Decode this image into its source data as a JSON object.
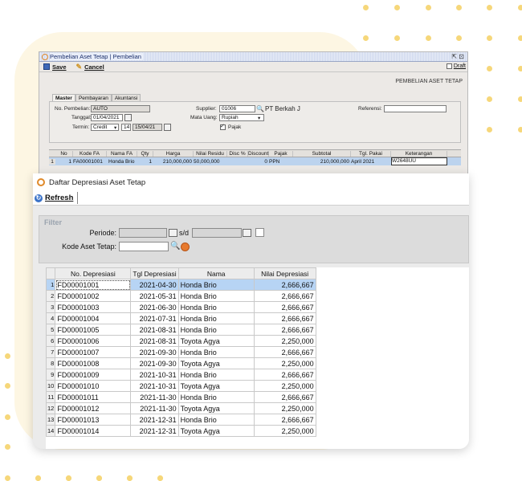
{
  "back_window": {
    "title": "Pembelian Aset Tetap | Pembelian",
    "window_buttons": "ᵒ̲ᶠ ⊞",
    "toolbar": {
      "save": "Save",
      "cancel": "Cancel",
      "draft": "Draft"
    },
    "header_label": "PEMBELIAN ASET TETAP",
    "tabs": [
      "Master",
      "Pembayaran",
      "Akuntansi"
    ],
    "form": {
      "no_pembelian_label": "No. Pembelian:",
      "no_pembelian": "AUTO",
      "tanggal_label": "Tanggal:",
      "tanggal": "01/04/2021",
      "termin_label": "Termin:",
      "termin": "Credit",
      "termin_days": "14",
      "termin_date": "15/04/21",
      "supplier_label": "Supplier:",
      "supplier_code": "01006",
      "supplier_name": "PT Berkah J",
      "mata_uang_label": "Mata Uang:",
      "mata_uang": "Rupiah",
      "pajak_label": "Pajak",
      "referensi_label": "Referensi:"
    },
    "grid": {
      "headers": [
        "No",
        "Kode FA",
        "Nama FA",
        "Qty",
        "Harga",
        "Nilai Residu",
        "Disc %",
        "Discount",
        "Pajak",
        "Subtotal",
        "Tgl. Pakai",
        "Keterangan"
      ],
      "row": {
        "rn": "1",
        "no": "1",
        "kode": "FA00001001",
        "nama": "Honda Brio",
        "qty": "1",
        "harga": "210,000,000",
        "residu": "50,000,000",
        "disc": "",
        "discount": "0",
        "pajak": "PPN",
        "subtotal": "210,000,000",
        "tgl": "April 2021",
        "ket": "W2648UU"
      }
    }
  },
  "front_window": {
    "title": "Daftar Depresiasi Aset Tetap",
    "refresh_label": "Refresh",
    "filter": {
      "title": "Filter",
      "periode_label": "Periode:",
      "sd_label": "s/d",
      "kode_label": "Kode Aset Tetap:"
    },
    "table": {
      "headers": [
        "No. Depresiasi",
        "Tgl Depresiasi",
        "Nama",
        "Nilai Depresiasi"
      ],
      "rows": [
        [
          "FD00001001",
          "2021-04-30",
          "Honda Brio",
          "2,666,667"
        ],
        [
          "FD00001002",
          "2021-05-31",
          "Honda Brio",
          "2,666,667"
        ],
        [
          "FD00001003",
          "2021-06-30",
          "Honda Brio",
          "2,666,667"
        ],
        [
          "FD00001004",
          "2021-07-31",
          "Honda Brio",
          "2,666,667"
        ],
        [
          "FD00001005",
          "2021-08-31",
          "Honda Brio",
          "2,666,667"
        ],
        [
          "FD00001006",
          "2021-08-31",
          "Toyota Agya",
          "2,250,000"
        ],
        [
          "FD00001007",
          "2021-09-30",
          "Honda Brio",
          "2,666,667"
        ],
        [
          "FD00001008",
          "2021-09-30",
          "Toyota Agya",
          "2,250,000"
        ],
        [
          "FD00001009",
          "2021-10-31",
          "Honda Brio",
          "2,666,667"
        ],
        [
          "FD00001010",
          "2021-10-31",
          "Toyota Agya",
          "2,250,000"
        ],
        [
          "FD00001011",
          "2021-11-30",
          "Honda Brio",
          "2,666,667"
        ],
        [
          "FD00001012",
          "2021-11-30",
          "Toyota Agya",
          "2,250,000"
        ],
        [
          "FD00001013",
          "2021-12-31",
          "Honda Brio",
          "2,666,667"
        ],
        [
          "FD00001014",
          "2021-12-31",
          "Toyota Agya",
          "2,250,000"
        ]
      ]
    }
  },
  "colors": {
    "accent_dots": "#f6d77a",
    "selection": "#b7d4f4",
    "background_blob": "#fdf6e3"
  }
}
